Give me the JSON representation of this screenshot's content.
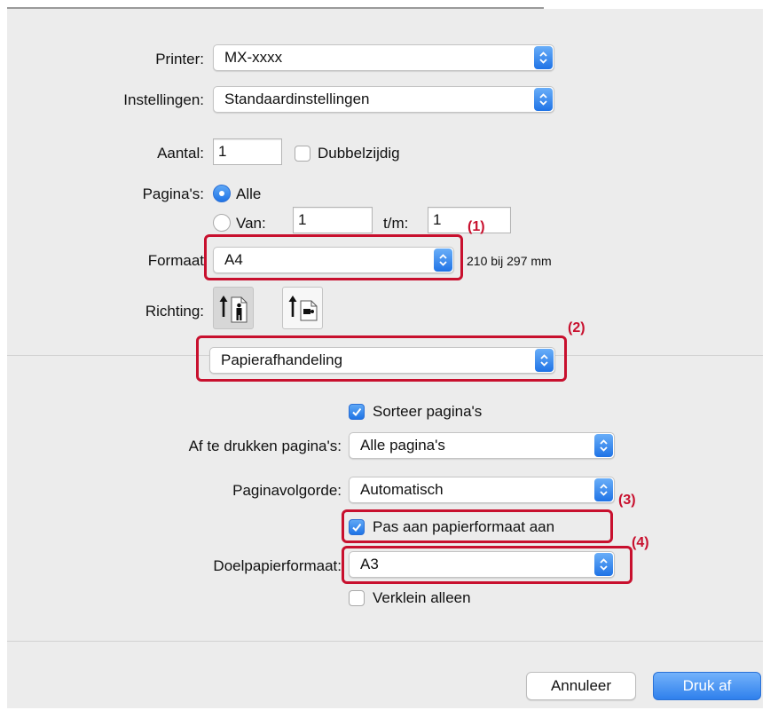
{
  "printer": {
    "label": "Printer:",
    "value": "MX-xxxx"
  },
  "presets": {
    "label": "Instellingen:",
    "value": "Standaardinstellingen"
  },
  "copies": {
    "label": "Aantal:",
    "value": "1",
    "duplex_label": "Dubbelzijdig",
    "duplex_checked": false
  },
  "pages": {
    "label": "Pagina's:",
    "all_label": "Alle",
    "range_label": "Van:",
    "from_value": "1",
    "to_label": "t/m:",
    "to_value": "1",
    "selected": "all"
  },
  "paper_size": {
    "label": "Formaat",
    "value": "A4",
    "dimensions": "210 bij 297 mm"
  },
  "orientation": {
    "label": "Richting:",
    "options": [
      "portrait-icon",
      "landscape-icon"
    ],
    "selected": "portrait"
  },
  "section_menu": {
    "value": "Papierafhandeling"
  },
  "paper_handling": {
    "collate_label": "Sorteer pagina's",
    "collate_checked": true,
    "pages_to_print_label": "Af te drukken pagina's:",
    "pages_to_print_value": "Alle pagina's",
    "page_order_label": "Paginavolgorde:",
    "page_order_value": "Automatisch",
    "scale_label": "Pas aan papierformaat aan",
    "scale_checked": true,
    "dest_size_label": "Doelpapierformaat:",
    "dest_size_value": "A3",
    "scale_down_label": "Verklein alleen",
    "scale_down_checked": false
  },
  "callouts": [
    "(1)",
    "(2)",
    "(3)",
    "(4)"
  ],
  "buttons": {
    "cancel": "Annuleer",
    "print": "Druk af"
  },
  "colors": {
    "accent": "#1f74e6",
    "highlight": "#c8102e",
    "panel": "#ececec"
  }
}
